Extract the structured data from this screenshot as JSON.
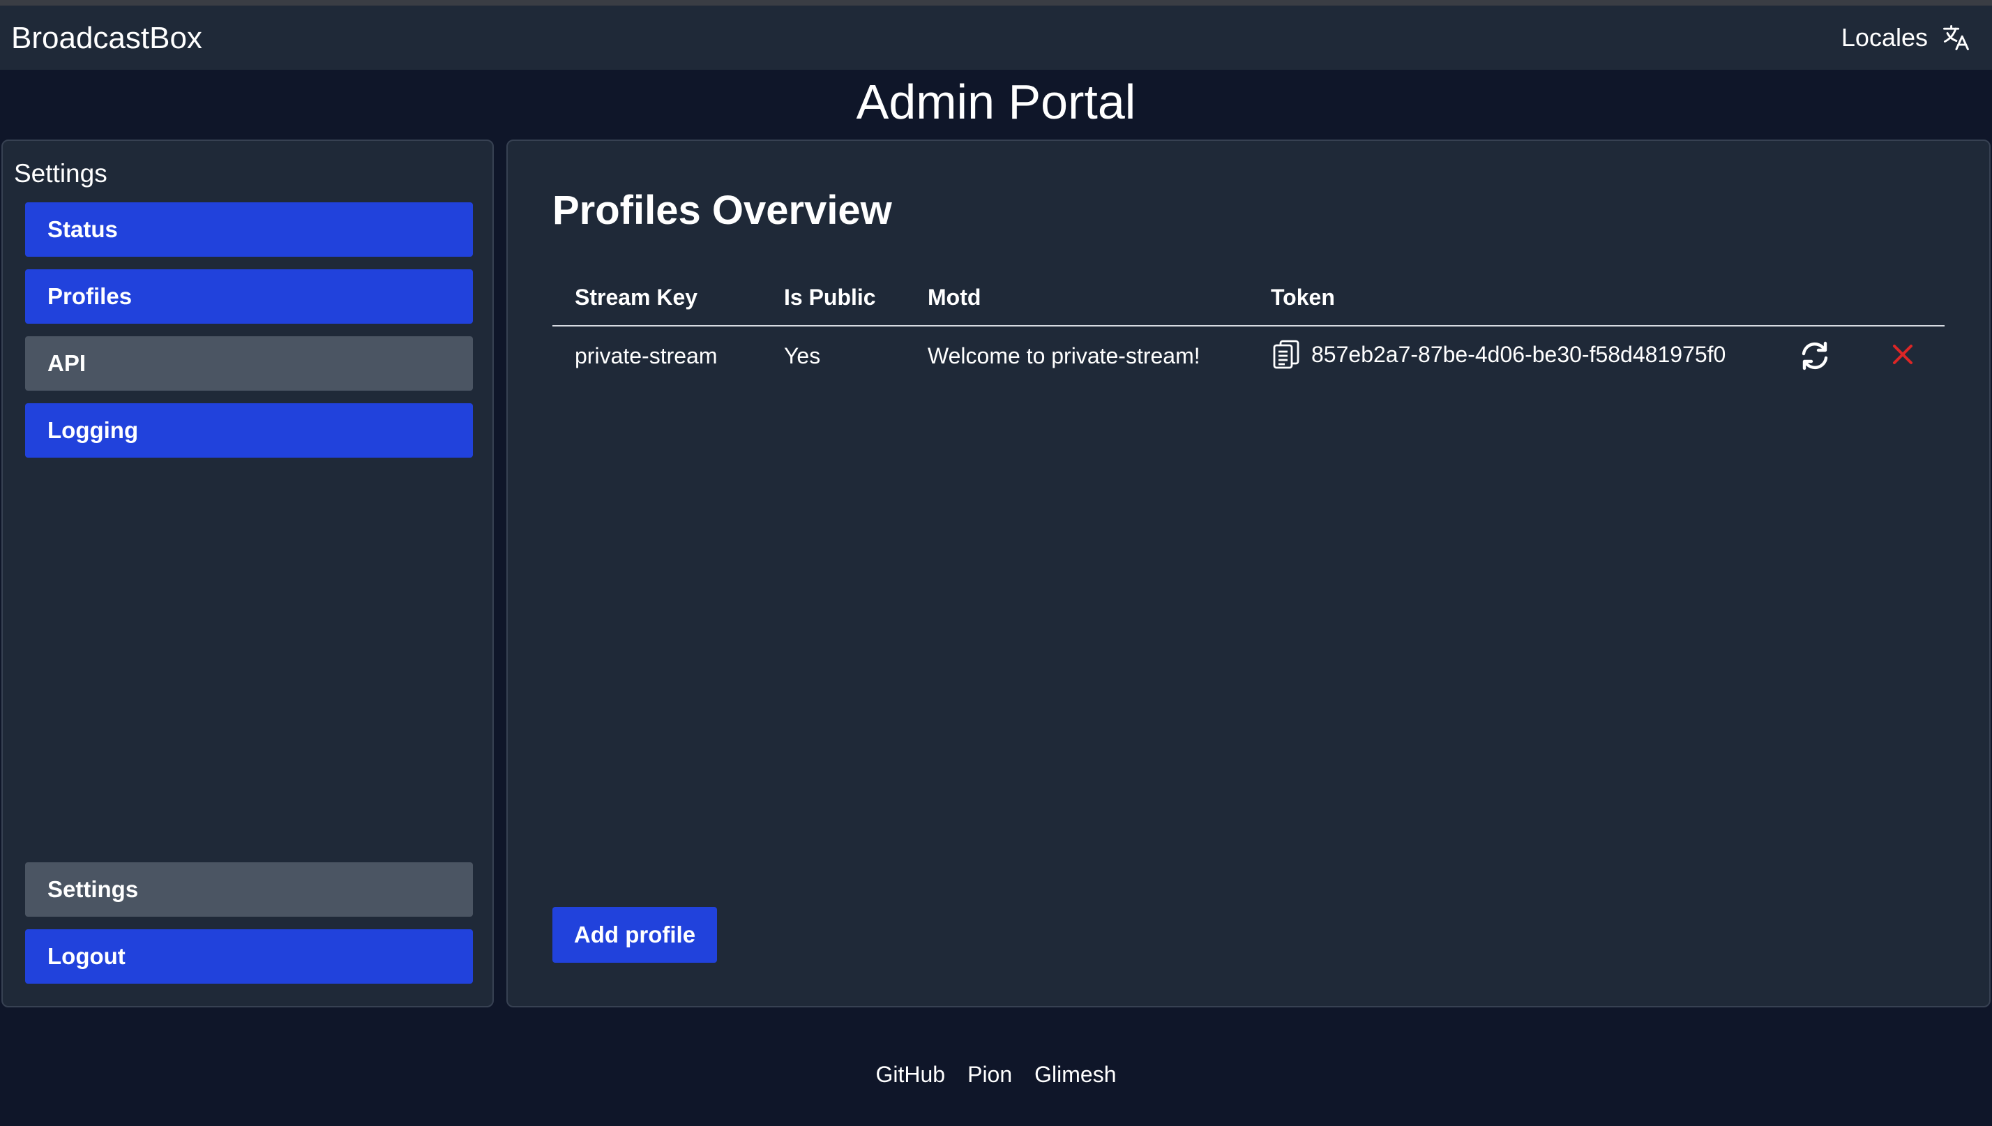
{
  "header": {
    "brand": "BroadcastBox",
    "locales_label": "Locales",
    "locales_icon": "translate-icon"
  },
  "page": {
    "title": "Admin Portal"
  },
  "sidebar": {
    "title": "Settings",
    "items": [
      {
        "label": "Status",
        "state": "default"
      },
      {
        "label": "Profiles",
        "state": "default"
      },
      {
        "label": "API",
        "state": "active"
      },
      {
        "label": "Logging",
        "state": "default"
      }
    ],
    "bottom_items": [
      {
        "label": "Settings",
        "state": "active"
      },
      {
        "label": "Logout",
        "state": "default"
      }
    ]
  },
  "main": {
    "title": "Profiles Overview",
    "table": {
      "columns": [
        "Stream Key",
        "Is Public",
        "Motd",
        "Token"
      ],
      "rows": [
        {
          "stream_key": "private-stream",
          "is_public": "Yes",
          "motd": "Welcome to private-stream!",
          "token": "857eb2a7-87be-4d06-be30-f58d481975f0",
          "copy_icon": "clipboard-icon",
          "refresh_icon": "refresh-icon",
          "delete_icon": "close-icon"
        }
      ]
    },
    "add_button": "Add profile"
  },
  "footer": {
    "links": [
      "GitHub",
      "Pion",
      "Glimesh"
    ]
  },
  "colors": {
    "background": "#0f1629",
    "panel": "#1f2938",
    "primary_button": "#2142dc",
    "secondary_button": "#4b5563",
    "delete_icon": "#dc2626"
  }
}
